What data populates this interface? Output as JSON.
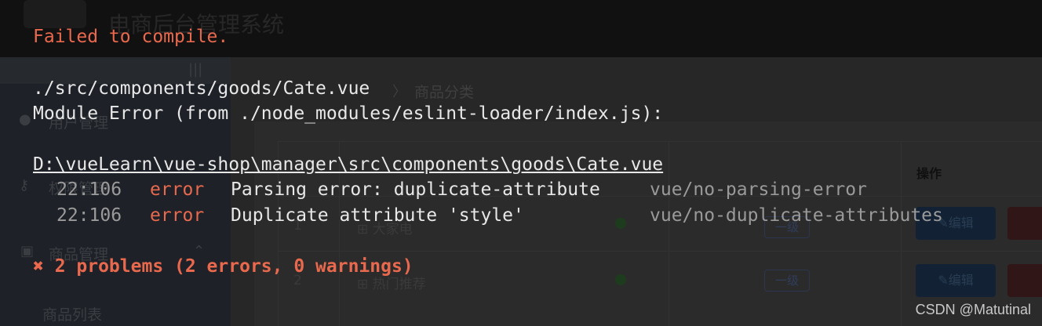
{
  "app": {
    "title": "电商后台管理系统",
    "toggle": "|||",
    "sidebar": {
      "items": [
        {
          "label": "用户管理",
          "icon": "user-icon"
        },
        {
          "label": "权限管理",
          "icon": "key-icon"
        },
        {
          "label": "商品管理",
          "icon": "shopping-bag-icon",
          "expanded": true
        },
        {
          "label": "商品列表",
          "icon": "none"
        }
      ]
    },
    "breadcrumb": {
      "separator": "〉",
      "current": "商品分类"
    },
    "table": {
      "ops_header": "操作",
      "rows": [
        {
          "index": "1",
          "name": "⊞ 大家电",
          "level": "一级",
          "edit_label": "✎编辑"
        },
        {
          "index": "2",
          "name": "⊞ 热门推荐",
          "level": "一级",
          "edit_label": "✎编辑"
        }
      ]
    }
  },
  "overlay": {
    "heading": "Failed to compile.",
    "file": "./src/components/goods/Cate.vue",
    "module_error": "Module Error (from ./node_modules/eslint-loader/index.js):",
    "abs_path": "D:\\vueLearn\\vue-shop\\manager\\src\\components\\goods\\Cate.vue",
    "problems": [
      {
        "loc": "22:106",
        "severity": "error",
        "message": "Parsing error: duplicate-attribute",
        "rule": "vue/no-parsing-error"
      },
      {
        "loc": "22:106",
        "severity": "error",
        "message": "Duplicate attribute 'style'",
        "rule": "vue/no-duplicate-attributes"
      }
    ],
    "summary": "✖ 2 problems (2 errors, 0 warnings)"
  },
  "watermark": "CSDN @Matutinal"
}
